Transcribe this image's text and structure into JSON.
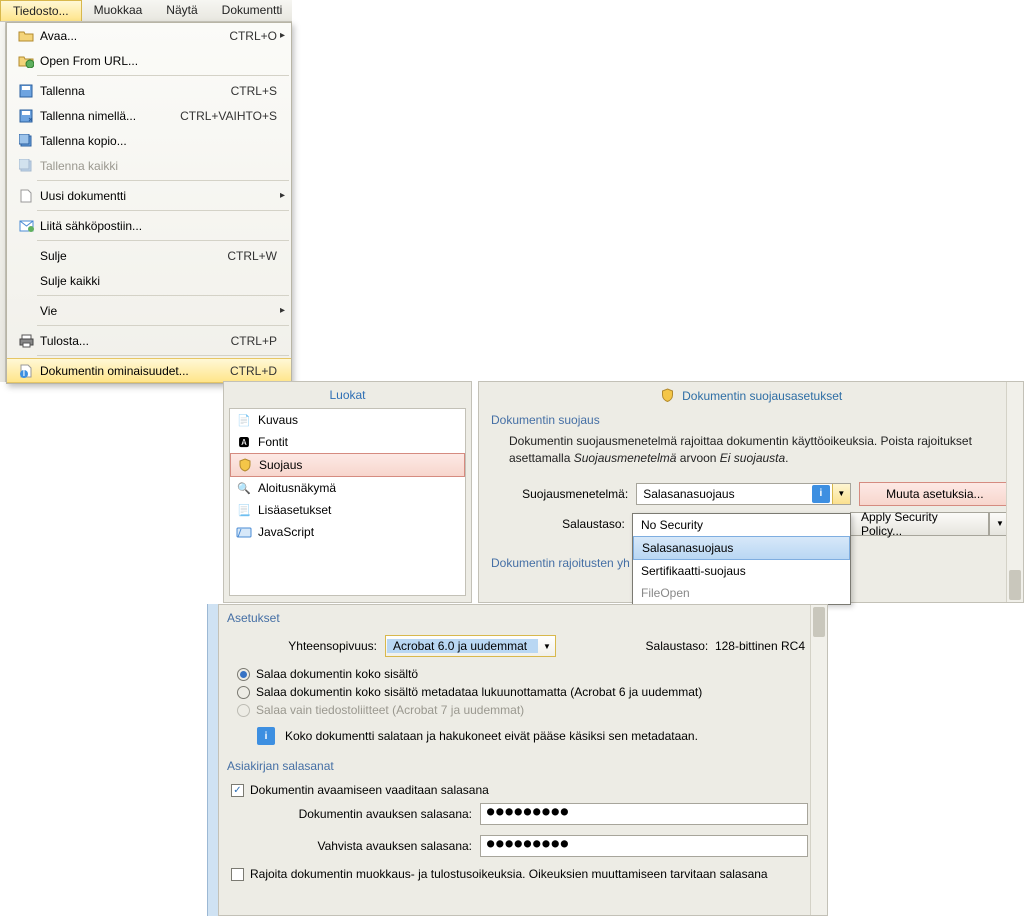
{
  "menubar": {
    "items": [
      "Tiedosto...",
      "Muokkaa",
      "Näytä",
      "Dokumentti"
    ]
  },
  "file_menu": {
    "open": "Avaa...",
    "open_sc": "CTRL+O",
    "open_url": "Open From URL...",
    "save": "Tallenna",
    "save_sc": "CTRL+S",
    "save_as": "Tallenna nimellä...",
    "save_as_sc": "CTRL+VAIHTO+S",
    "save_copy": "Tallenna kopio...",
    "save_all": "Tallenna kaikki",
    "new_doc": "Uusi dokumentti",
    "email": "Liitä sähköpostiin...",
    "close": "Sulje",
    "close_sc": "CTRL+W",
    "close_all": "Sulje kaikki",
    "export": "Vie",
    "print": "Tulosta...",
    "print_sc": "CTRL+P",
    "props": "Dokumentin ominaisuudet...",
    "props_sc": "CTRL+D"
  },
  "categories": {
    "title": "Luokat",
    "items": [
      "Kuvaus",
      "Fontit",
      "Suojaus",
      "Aloitusnäkymä",
      "Lisäasetukset",
      "JavaScript"
    ]
  },
  "security": {
    "title": "Dokumentin suojausasetukset",
    "group": "Dokumentin suojaus",
    "desc1": "Dokumentin suojausmenetelmä rajoittaa dokumentin käyttöoikeuksia. Poista rajoitukset asettamalla ",
    "desc_i1": "Suojausmenetelmä",
    "desc_mid": " arvoon ",
    "desc_i2": "Ei suojausta",
    "method_lbl": "Suojausmenetelmä:",
    "method_val": "Salasanasuojaus",
    "level_lbl": "Salaustaso:",
    "change_btn": "Muuta asetuksia...",
    "apply_btn": "Apply Security Policy...",
    "summary": "Dokumentin rajoitusten yh",
    "options": [
      "No Security",
      "Salasanasuojaus",
      "Sertifikaatti-suojaus",
      "FileOpen"
    ]
  },
  "settings": {
    "grp1": "Asetukset",
    "compat_lbl": "Yhteensopivuus:",
    "compat_val": "Acrobat 6.0 ja uudemmat",
    "level_lbl": "Salaustaso:",
    "level_val": "128-bittinen RC4",
    "r1": "Salaa dokumentin koko sisältö",
    "r2": "Salaa dokumentin koko sisältö metadataa lukuunottamatta (Acrobat 6 ja uudemmat)",
    "r3": "Salaa vain tiedostoliitteet  (Acrobat 7 ja uudemmat)",
    "info": "Koko dokumentti salataan ja hakukoneet eivät pääse käsiksi sen metadataan.",
    "grp2": "Asiakirjan salasanat",
    "chk1": "Dokumentin avaamiseen vaaditaan salasana",
    "pass1_lbl": "Dokumentin avauksen salasana:",
    "pass2_lbl": "Vahvista avauksen salasana:",
    "pass_mask": "●●●●●●●●●",
    "chk2": "Rajoita dokumentin muokkaus- ja tulostusoikeuksia. Oikeuksien muuttamiseen tarvitaan salasana"
  }
}
